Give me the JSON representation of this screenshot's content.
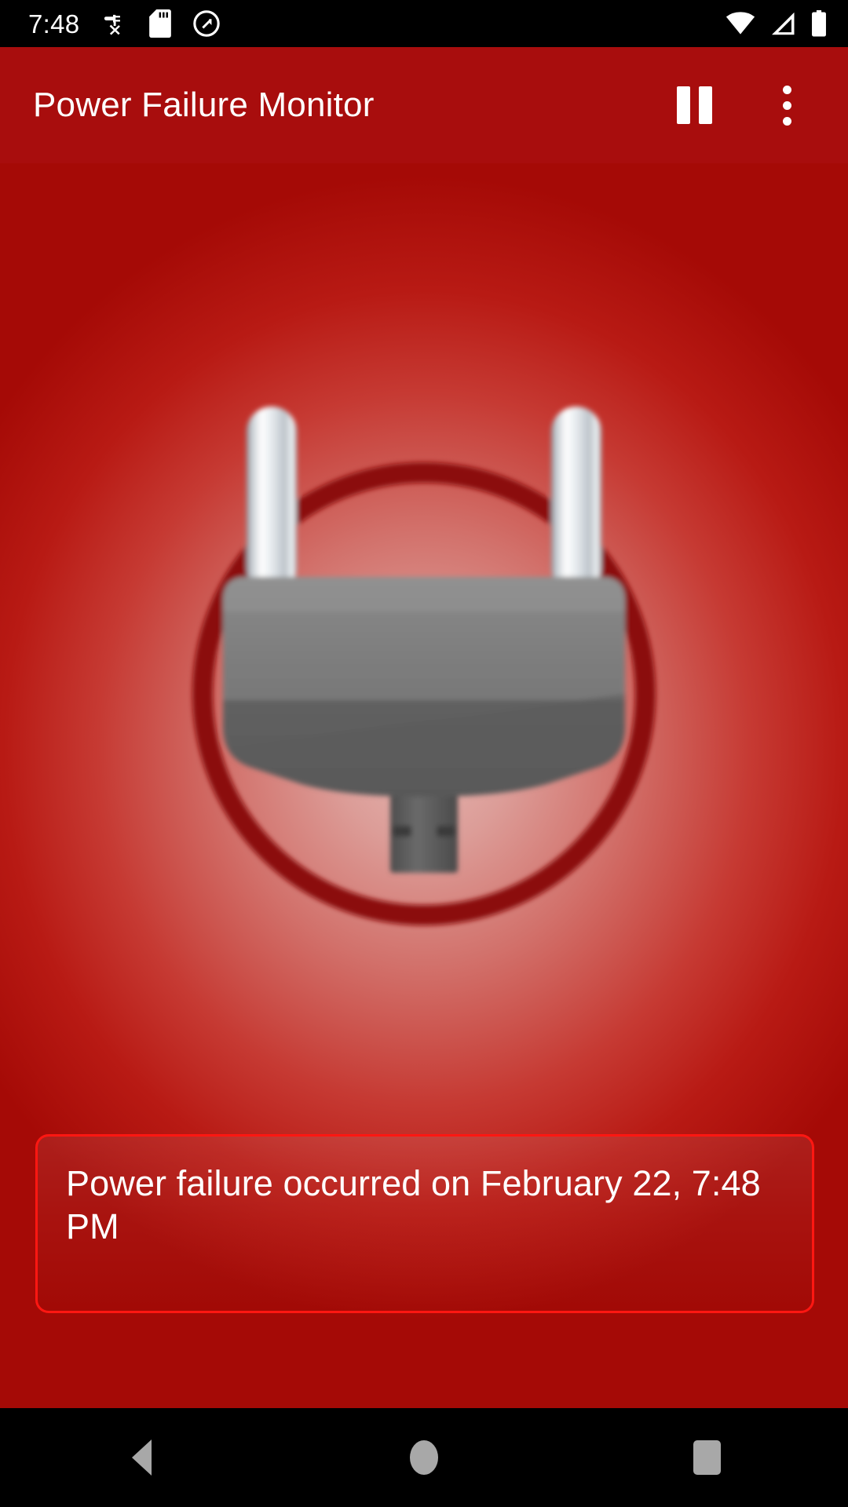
{
  "status_bar": {
    "clock": "7:48",
    "left_icons": [
      {
        "name": "power-off-plug-icon",
        "label": "plug disconnected"
      },
      {
        "name": "sd-card-icon",
        "label": "SD card"
      },
      {
        "name": "do-not-disturb-icon",
        "label": "Do not disturb"
      }
    ],
    "right_icons": [
      {
        "name": "wifi-icon",
        "label": "Wi-Fi full"
      },
      {
        "name": "cellular-signal-icon",
        "label": "Mobile signal"
      },
      {
        "name": "battery-icon",
        "label": "Battery"
      }
    ]
  },
  "app_bar": {
    "title": "Power Failure Monitor",
    "pause_label": "Pause",
    "overflow_label": "More options",
    "background_color": "#a80d0d",
    "title_color": "#ffffff"
  },
  "content": {
    "illustration": {
      "name": "unplugged-power-plug-illustration",
      "ring_color": "#8b0b08",
      "plug_body_color": "#6b6b6b",
      "prong_color": "#d8dde2"
    },
    "background": {
      "center_color": "#e6b6b1",
      "edge_color": "#a50a06"
    }
  },
  "message_card": {
    "text": "Power failure occurred on February 22, 7:48 PM",
    "border_color": "#ff1712",
    "text_color": "#ffffff"
  },
  "nav_bar": {
    "back_label": "Back",
    "home_label": "Home",
    "recents_label": "Recent apps",
    "icon_color": "#a8a8a8"
  }
}
